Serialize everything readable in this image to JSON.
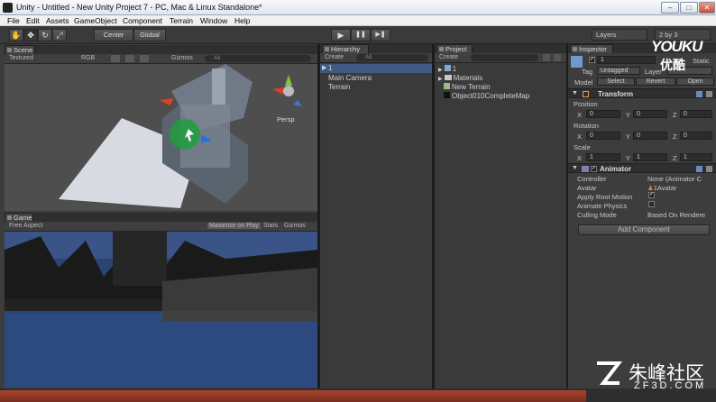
{
  "window": {
    "title": "Unity - Untitled - New Unity Project 7 - PC, Mac & Linux Standalone*",
    "minimize": "–",
    "maximize": "□",
    "close": "✕"
  },
  "menu": [
    "File",
    "Edit",
    "Assets",
    "GameObject",
    "Component",
    "Terrain",
    "Window",
    "Help"
  ],
  "toolbar": {
    "pivot": "Center",
    "space": "Global",
    "play": "▶",
    "pause": "❚❚",
    "step": "▶❚",
    "layers": "Layers",
    "layout": "2 by 3"
  },
  "scene": {
    "tab": "Scene",
    "shading": "Textured",
    "render": "RGB",
    "gizmos": "Gizmos",
    "search": "All",
    "persp": "Persp"
  },
  "game": {
    "tab": "Game",
    "aspect": "Free Aspect",
    "maximize": "Maximize on Play",
    "stats": "Stats",
    "gizmos": "Gizmos"
  },
  "hierarchy": {
    "tab": "Hierarchy",
    "create": "Create",
    "search": "All",
    "items": [
      "1",
      "Main Camera",
      "Terrain"
    ]
  },
  "project": {
    "tab": "Project",
    "create": "Create",
    "items": [
      "1",
      "Materials",
      "New Terrain",
      "Object010CompleteMap"
    ]
  },
  "inspector": {
    "tab": "Inspector",
    "object_name": "1",
    "static": "Static",
    "tag_label": "Tag",
    "tag_value": "Untagged",
    "layer_label": "Layer",
    "prefab_model": "Model",
    "prefab_select": "Select",
    "prefab_revert": "Revert",
    "prefab_open": "Open",
    "transform": {
      "title": "Transform",
      "position": "Position",
      "rotation": "Rotation",
      "scale": "Scale",
      "pos": [
        "0",
        "0",
        "0"
      ],
      "rot": [
        "0",
        "0",
        "0"
      ],
      "scl": [
        "1",
        "1",
        "1"
      ],
      "axes": [
        "X",
        "Y",
        "Z"
      ]
    },
    "animator": {
      "title": "Animator",
      "controller_label": "Controller",
      "controller_value": "None (Animator C",
      "avatar_label": "Avatar",
      "avatar_value": "1Avatar",
      "root_motion_label": "Apply Root Motion",
      "animate_physics_label": "Animate Physics",
      "culling_label": "Culling Mode",
      "culling_value": "Based On Rendere"
    },
    "add_component": "Add Component"
  },
  "watermark": {
    "youku": "YOUKU",
    "youku_cn": "优酷",
    "brand_cn": "朱峰社区",
    "brand_url": "ZF3D.COM"
  }
}
